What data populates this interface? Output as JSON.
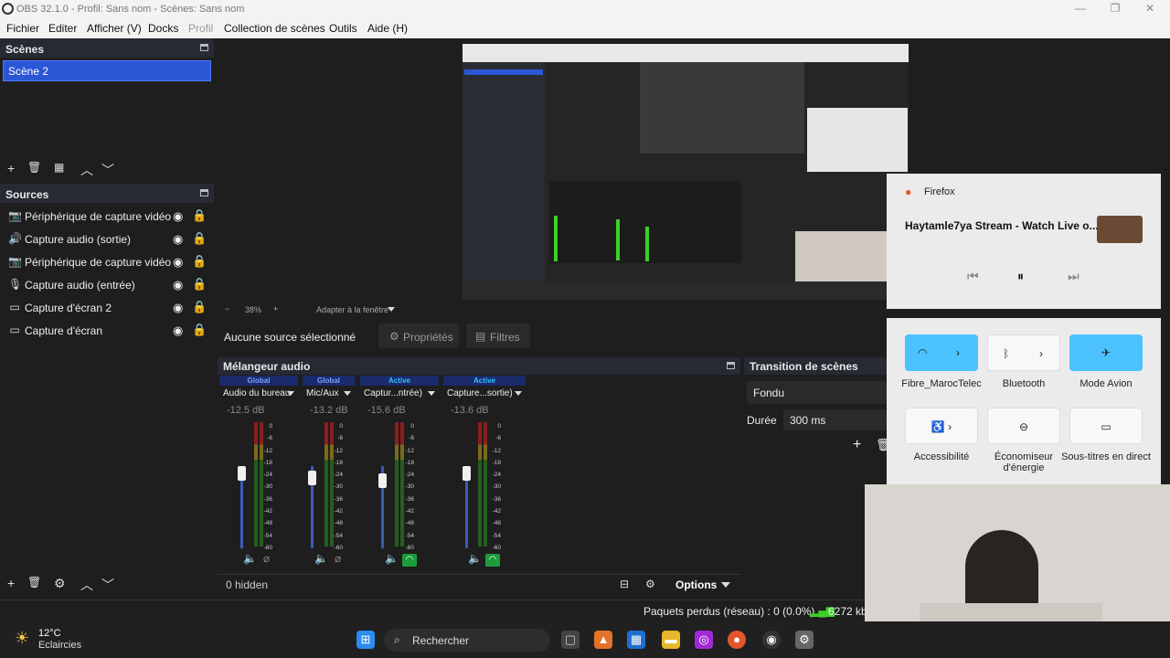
{
  "window": {
    "title": "OBS 32.1.0 - Profil: Sans nom - Scènes: Sans nom",
    "min": "—",
    "max": "❐",
    "close": "✕"
  },
  "menu": [
    "Fichier",
    "Editer",
    "Afficher (V)",
    "Docks",
    "Profil",
    "Collection de scènes",
    "Outils",
    "Aide (H)"
  ],
  "scenes": {
    "title": "Scènes",
    "items": [
      "Scène 2"
    ],
    "toolbar": [
      "+",
      "🗑",
      "▦",
      "︿",
      "﹀"
    ]
  },
  "sources": {
    "title": "Sources",
    "items": [
      {
        "icon": "📷",
        "icon_name": "camera-icon",
        "label": "Périphérique de capture vidéo"
      },
      {
        "icon": "🔊",
        "icon_name": "speaker-icon",
        "label": "Capture audio (sortie)"
      },
      {
        "icon": "📷",
        "icon_name": "camera-icon",
        "label": "Périphérique de capture vidéo"
      },
      {
        "icon": "🎙",
        "icon_name": "microphone-icon",
        "label": "Capture audio (entrée)"
      },
      {
        "icon": "▭",
        "icon_name": "monitor-icon",
        "label": "Capture d'écran 2"
      },
      {
        "icon": "▭",
        "icon_name": "monitor-icon",
        "label": "Capture d'écran"
      }
    ],
    "toolbar": [
      "+",
      "🗑",
      "⚙",
      "︿",
      "﹀"
    ]
  },
  "preview_bar": {
    "minus": "−",
    "zoom": "38%",
    "plus": "+",
    "fit": "Adapter à la fenêtre"
  },
  "selection": {
    "none_label": "Aucune source sélectionné",
    "properties": "Propriétés",
    "filters": "Filtres"
  },
  "mixer": {
    "title": "Mélangeur audio",
    "channels": [
      {
        "status": "Global",
        "name": "Audio du bureau",
        "db": "-12.5 dB",
        "level": 0.55
      },
      {
        "status": "Global",
        "name": "Mic/Aux",
        "db": "-13.2 dB",
        "level": 0.52
      },
      {
        "status": "Active",
        "name": "Captur...ntrée)",
        "db": "-15.6 dB",
        "level": 0.5
      },
      {
        "status": "Active",
        "name": "Capture...sortie)",
        "db": "-13.6 dB",
        "level": 0.55
      }
    ],
    "scale": [
      "0",
      "-6",
      "-12",
      "-18",
      "-24",
      "-30",
      "-36",
      "-42",
      "-48",
      "-54",
      "-60"
    ],
    "hidden": "0 hidden",
    "options": "Options"
  },
  "transition": {
    "title": "Transition de scènes",
    "type": "Fondu",
    "duration_label": "Durée",
    "duration_value": "300 ms"
  },
  "status": {
    "dropped": "Paquets perdus (réseau) : 0 (0.0%)",
    "bitrate": "6272 kb"
  },
  "media": {
    "app": "Firefox",
    "title": "Haytamle7ya Stream - Watch Live o..."
  },
  "quick_settings": {
    "tiles": [
      {
        "label": "Fibre_MarocTelec",
        "icon": "wifi-icon",
        "active": true
      },
      {
        "label": "Bluetooth",
        "icon": "bluetooth-icon",
        "active": false
      },
      {
        "label": "Mode Avion",
        "icon": "airplane-icon",
        "active": true
      },
      {
        "label": "Accessibilité",
        "icon": "accessibility-icon",
        "active": false
      },
      {
        "label": "Économiseur d'énergie",
        "icon": "battery-saver-icon",
        "active": false
      },
      {
        "label": "Sous-titres en direct",
        "icon": "captions-icon",
        "active": false
      }
    ]
  },
  "taskbar": {
    "temp": "12°C",
    "weather": "Eclaircies",
    "search": "Rechercher"
  },
  "colors": {
    "accent": "#3d6cf2",
    "tile_active": "#4cc2ff",
    "meter_green": "#3bd12a",
    "meter_red": "#8b1d1d"
  }
}
